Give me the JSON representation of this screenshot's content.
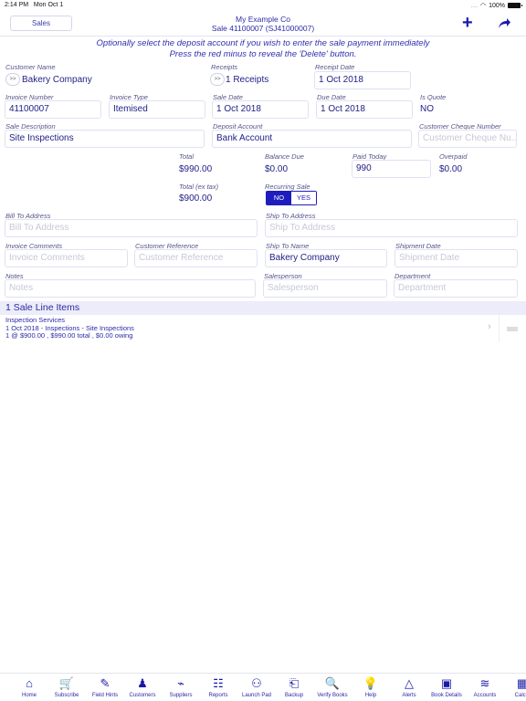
{
  "status_bar": {
    "time": "2:14 PM",
    "date": "Mon Oct 1",
    "signal": "....",
    "battery": "100%"
  },
  "navbar": {
    "back_label": "Sales",
    "company": "My Example Co",
    "subtitle": "Sale 41100007 (SJ41000007)",
    "add_icon": "plus-icon",
    "share_icon": "share-arrow-icon"
  },
  "hint": {
    "line1": "Optionally select the deposit account if you wish to enter the sale payment immediately",
    "line2": "Press the red minus to reveal the 'Delete' button."
  },
  "form": {
    "customer_name": {
      "label": "Customer Name",
      "value": "Bakery Company",
      "chevron": ">>"
    },
    "receipts": {
      "label": "Receipts",
      "value": "1 Receipts",
      "chevron": ">>"
    },
    "receipt_date": {
      "label": "Receipt Date",
      "value": "1 Oct 2018"
    },
    "invoice_number": {
      "label": "Invoice Number",
      "value": "41100007"
    },
    "invoice_type": {
      "label": "Invoice Type",
      "value": "Itemised"
    },
    "sale_date": {
      "label": "Sale Date",
      "value": "1 Oct 2018"
    },
    "due_date": {
      "label": "Due Date",
      "value": "1 Oct 2018"
    },
    "is_quote": {
      "label": "Is Quote",
      "value": "NO"
    },
    "sale_description": {
      "label": "Sale Description",
      "value": "Site Inspections"
    },
    "deposit_account": {
      "label": "Deposit Account",
      "value": "Bank Account"
    },
    "customer_cheque_number": {
      "label": "Customer Cheque Number",
      "placeholder": "Customer Cheque Nu..."
    },
    "total": {
      "label": "Total",
      "value": "$990.00"
    },
    "balance_due": {
      "label": "Balance Due",
      "value": "$0.00"
    },
    "paid_today": {
      "label": "Paid Today",
      "value": "990"
    },
    "overpaid": {
      "label": "Overpaid",
      "value": "$0.00"
    },
    "total_ex_tax": {
      "label": "Total (ex tax)",
      "value": "$900.00"
    },
    "recurring_sale": {
      "label": "Recurring Sale",
      "options": [
        "NO",
        "YES"
      ],
      "selected": "NO"
    },
    "bill_to_address": {
      "label": "Bill To Address",
      "placeholder": "Bill To Address"
    },
    "ship_to_address": {
      "label": "Ship To Address",
      "placeholder": "Ship To Address"
    },
    "invoice_comments": {
      "label": "Invoice Comments",
      "placeholder": "Invoice Comments"
    },
    "customer_reference": {
      "label": "Customer Reference",
      "placeholder": "Customer Reference"
    },
    "ship_to_name": {
      "label": "Ship To Name",
      "value": "Bakery Company"
    },
    "shipment_date": {
      "label": "Shipment Date",
      "placeholder": "Shipment Date"
    },
    "notes": {
      "label": "Notes",
      "placeholder": "Notes"
    },
    "salesperson": {
      "label": "Salesperson",
      "placeholder": "Salesperson"
    },
    "department": {
      "label": "Department",
      "placeholder": "Department"
    }
  },
  "line_items": {
    "header": "1 Sale Line Items",
    "items": [
      {
        "line1": "Inspection Services",
        "line2": "1 Oct 2018 - Inspections - Site Inspections",
        "line3": "1 @ $900.00 , $990.00 total , $0.00 owing"
      }
    ]
  },
  "tabbar": [
    {
      "label": "Home",
      "icon": "home-icon",
      "glyph": "⌂"
    },
    {
      "label": "Subscribe",
      "icon": "cart-icon",
      "glyph": "🛒"
    },
    {
      "label": "Field Hints",
      "icon": "field-hints-icon",
      "glyph": "✎"
    },
    {
      "label": "Customers",
      "icon": "customers-icon",
      "glyph": "♟"
    },
    {
      "label": "Suppliers",
      "icon": "suppliers-icon",
      "glyph": "⌁"
    },
    {
      "label": "Reports",
      "icon": "reports-icon",
      "glyph": "☷"
    },
    {
      "label": "Launch Pad",
      "icon": "launch-pad-icon",
      "glyph": "⚇"
    },
    {
      "label": "Backup",
      "icon": "backup-icon",
      "glyph": "⎗"
    },
    {
      "label": "Verify Books",
      "icon": "verify-books-icon",
      "glyph": "🔍"
    },
    {
      "label": "Help",
      "icon": "lightbulb-icon",
      "glyph": "💡"
    },
    {
      "label": "Alerts",
      "icon": "alert-triangle-icon",
      "glyph": "△"
    },
    {
      "label": "Book Details",
      "icon": "book-details-icon",
      "glyph": "▣"
    },
    {
      "label": "Accounts",
      "icon": "accounts-icon",
      "glyph": "≋"
    },
    {
      "label": "Calcul",
      "icon": "calculator-icon",
      "glyph": "▦"
    }
  ]
}
